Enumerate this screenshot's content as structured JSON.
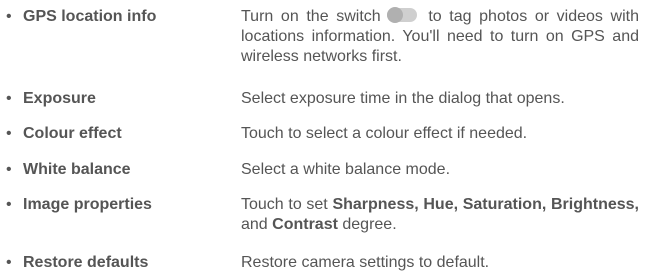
{
  "bullet": "•",
  "items": [
    {
      "term": "GPS location info",
      "desc_before": "Turn on the switch",
      "desc_after": " to tag photos or videos with locations information. You'll need to turn on GPS and wireless networks first.",
      "toggle_icon": "toggle-switch-off-icon"
    },
    {
      "term": "Exposure",
      "desc": "Select exposure time in the dialog that opens."
    },
    {
      "term": "Colour effect",
      "desc": "Touch to select a colour effect if needed."
    },
    {
      "term": "White balance",
      "desc": "Select a white balance mode."
    },
    {
      "term": "Image properties",
      "desc_parts": {
        "p1": "Touch to set ",
        "b1": "Sharpness, Hue, Saturation, Brightness,",
        "p2": " and ",
        "b2": "Contrast",
        "p3": " degree."
      }
    },
    {
      "term": "Restore defaults",
      "desc": "Restore camera settings to default."
    }
  ],
  "colors": {
    "text": "#555555",
    "toggle_track": "#cfcfcf",
    "toggle_knob": "#b0b0b0"
  }
}
